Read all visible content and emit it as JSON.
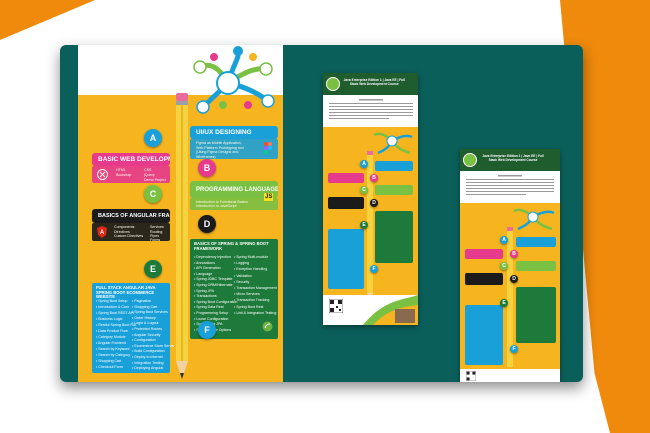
{
  "main_poster": {
    "section_a": {
      "letter": "A",
      "title": "UI/UX DESIGNING",
      "items": [
        "Figma as Mobile Application,",
        "Web Platform Prototyping tool",
        "(Using Figma Designs and",
        "Wireframes)"
      ]
    },
    "section_b": {
      "letter": "B",
      "title": "BASIC WEB DEVELOPMENT",
      "items": [
        "HTML",
        "Bootstrap",
        "CSS",
        "jQuery",
        "Demo Project"
      ]
    },
    "section_c": {
      "letter": "C",
      "title": "PROGRAMMING LANGUAGES",
      "items": [
        "Introduction to Functional Basics",
        "Introduction to JavaScript"
      ],
      "logo": "JS"
    },
    "section_d": {
      "letter": "D",
      "title": "BASICS OF ANGULAR FRAME WORK",
      "items": [
        "Components",
        "Directives",
        "Custom Directives",
        "Services",
        "Routing",
        "Pipes",
        "Forms"
      ]
    },
    "section_e": {
      "letter": "E",
      "title": "BASICS OF SPRING & SPRING BOOT FRAMEWORK",
      "items_left": [
        "Dependency Injection",
        "Annotations",
        "API Generation",
        "Language",
        "Spring JDBC Template",
        "Spring ORM/Hibernate",
        "Spring JPA",
        "Transactions",
        "Spring Boot Configuration",
        "Spring Data Rest",
        "Programming Setup",
        "Loose Configuration",
        "Spring Data JPA",
        "Spring Profile Options"
      ],
      "items_right": [
        "Spring Multi-module",
        "Logging",
        "Exception Handling",
        "Validation",
        "Security",
        "Transaction Management",
        "Micro Services",
        "Transaction Tracking",
        "Spring Boot Rest",
        "Unit & Integration Testing"
      ]
    },
    "section_f": {
      "letter": "F",
      "title": "FULL STACK ANGULAR JAVA SPRING BOOT ECOMMERCE WEBSITE",
      "items_left": [
        "Spring Boot Setup",
        "Introduction & Core",
        "Spring Boot REST API",
        "Business Logic",
        "Restful Spring Boot Full",
        "Data Product Flow",
        "Category Module",
        "Angular Frontend",
        "Search by Keyword",
        "Search by Category",
        "Shopping Cart",
        "Checkout Form"
      ],
      "items_right": [
        "Pagination",
        "Shopping Cart",
        "Spring Boot Services",
        "Order History",
        "Login & Logout",
        "Protected Routes",
        "Angular Security",
        "Configuration",
        "Ecommerce Store Server",
        "Build Configuration",
        "Deploy to Internet",
        "Integration Testing",
        "Deploying Angular"
      ]
    }
  },
  "brand_card_title": "Java Enterprise Edition 1 | Java EE | Full Stack Web Development Course",
  "colors": {
    "board": "#0b5f5b",
    "poster": "#f6b51f",
    "orange_bg": "#ef8a0c",
    "blue": "#1aa0d8",
    "pink": "#e63b8d",
    "green": "#7ac043",
    "black": "#1b1b1b",
    "dark_green": "#1f5d2f"
  },
  "icons": [
    "angular-logo-icon",
    "js-logo-icon",
    "figma-icon",
    "spring-icon",
    "qr-code-icon",
    "pencil-icon",
    "mind-map-icon"
  ]
}
